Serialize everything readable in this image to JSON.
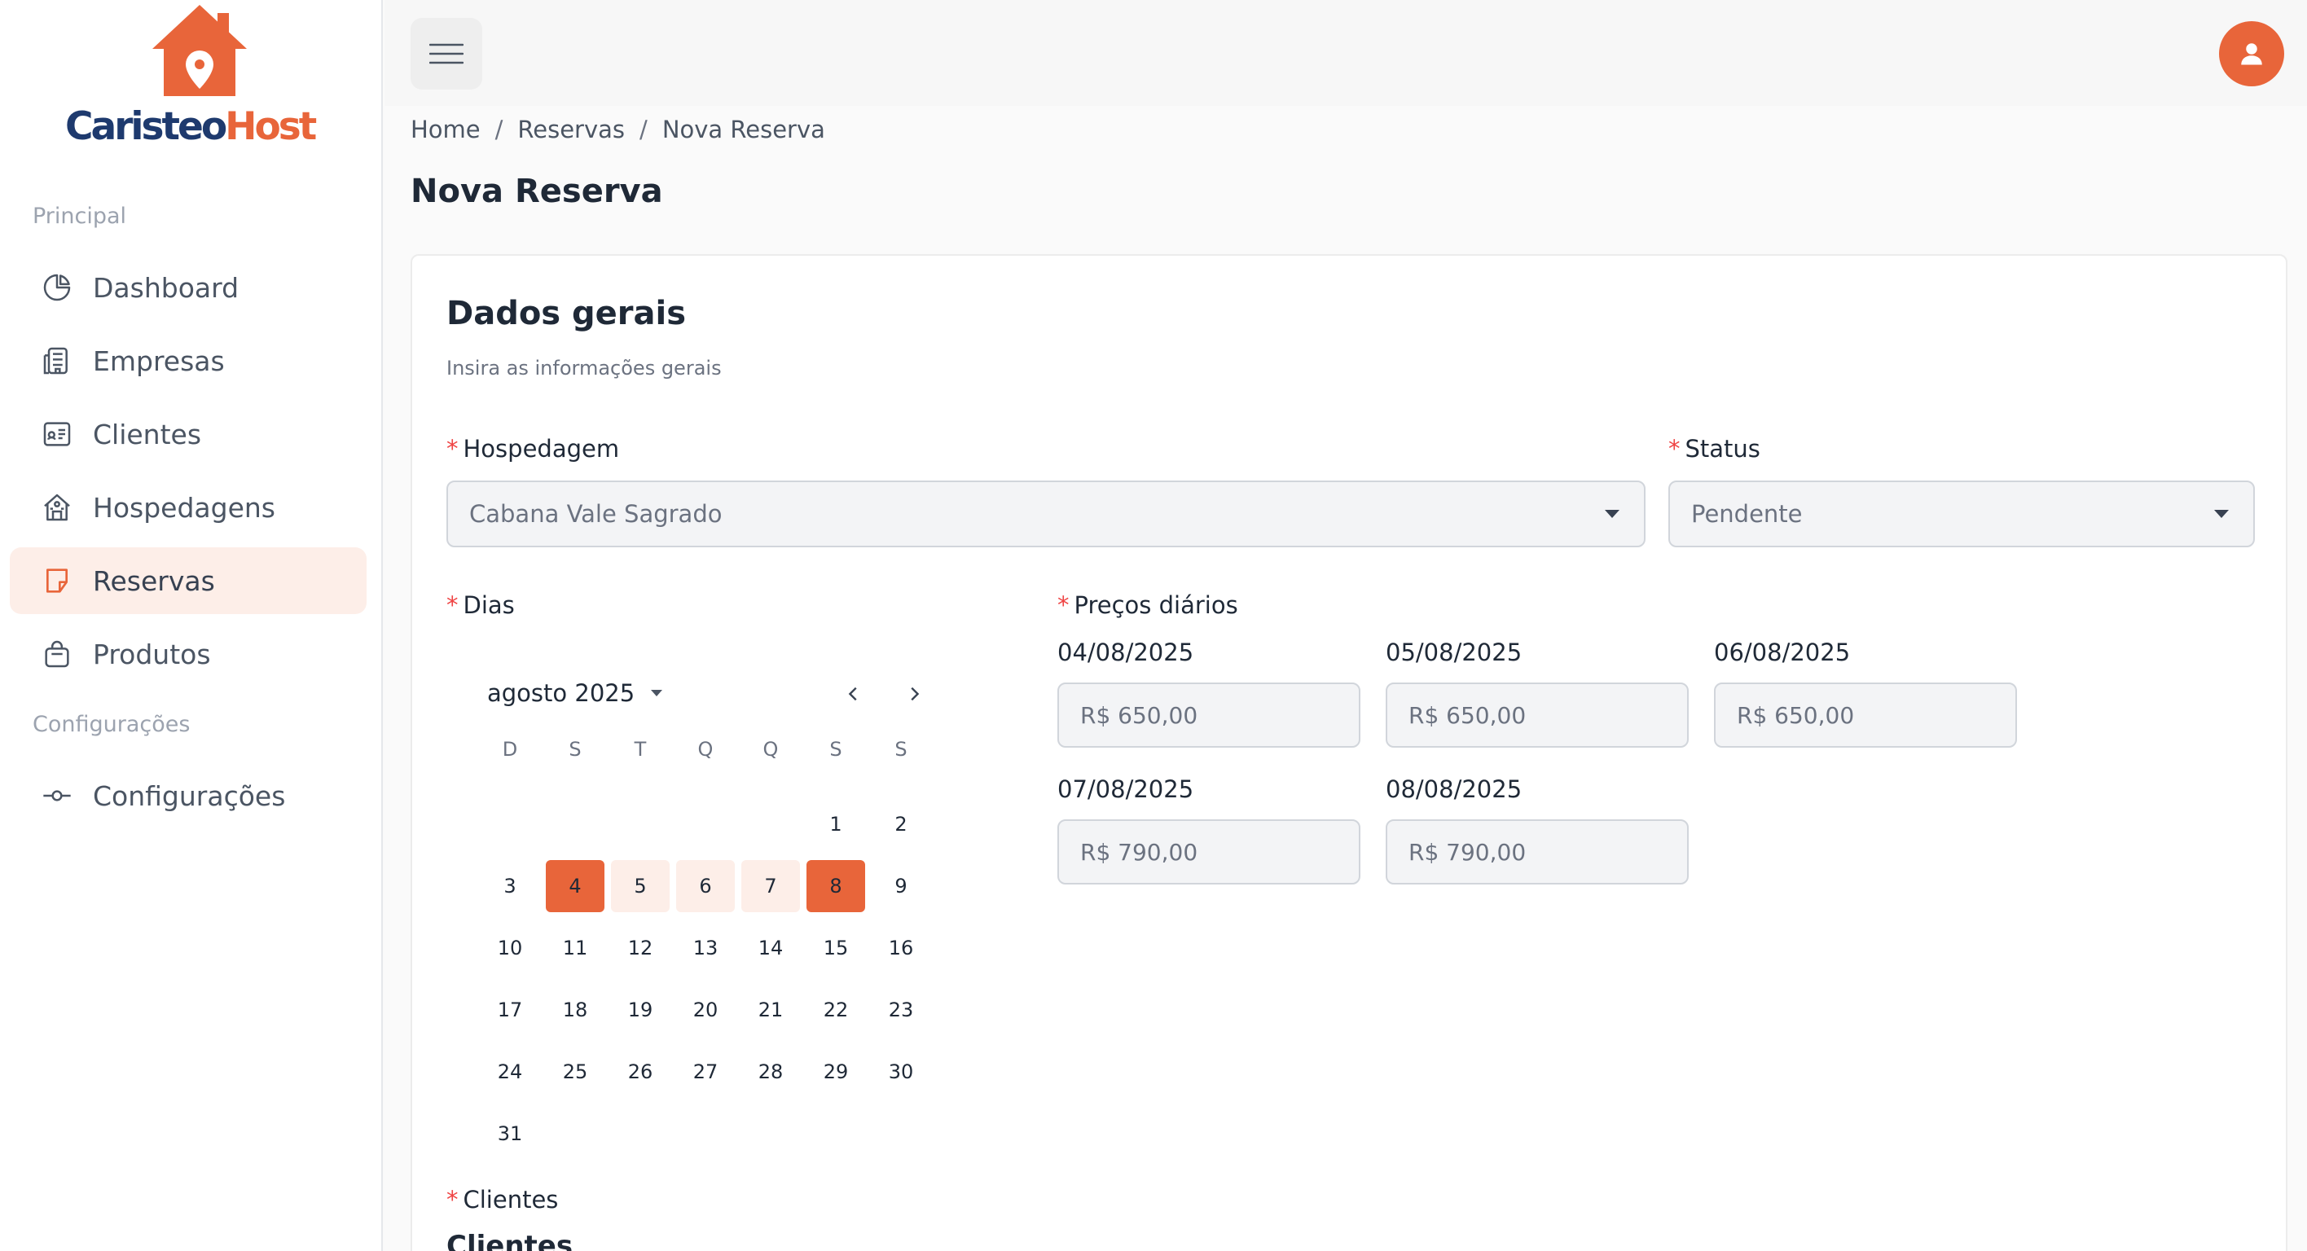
{
  "brand": {
    "name_part1": "Caristeo",
    "name_part2": "Host",
    "color_primary": "#e8653a",
    "color_dark": "#1e3a6e"
  },
  "sidebar": {
    "section_main": "Principal",
    "section_config": "Configurações",
    "items": [
      {
        "label": "Dashboard",
        "icon": "pie-chart-icon"
      },
      {
        "label": "Empresas",
        "icon": "building-icon"
      },
      {
        "label": "Clientes",
        "icon": "id-card-icon"
      },
      {
        "label": "Hospedagens",
        "icon": "house-icon"
      },
      {
        "label": "Reservas",
        "icon": "booking-icon",
        "active": true
      },
      {
        "label": "Produtos",
        "icon": "bag-icon"
      }
    ],
    "config_item": {
      "label": "Configurações",
      "icon": "commit-icon"
    }
  },
  "breadcrumb": [
    "Home",
    "Reservas",
    "Nova Reserva"
  ],
  "page_title": "Nova Reserva",
  "card": {
    "title": "Dados gerais",
    "subtitle": "Insira as informações gerais"
  },
  "form": {
    "hospedagem_label": "Hospedagem",
    "hospedagem_value": "Cabana Vale Sagrado",
    "status_label": "Status",
    "status_value": "Pendente",
    "dias_label": "Dias",
    "precos_label": "Preços diários",
    "clientes_label": "Clientes",
    "clientes_section": "Clientes"
  },
  "calendar": {
    "month": "agosto 2025",
    "weekdays": [
      "D",
      "S",
      "T",
      "Q",
      "Q",
      "S",
      "S"
    ],
    "weeks": [
      [
        "",
        "",
        "",
        "",
        "",
        "1",
        "2"
      ],
      [
        "3",
        "4",
        "5",
        "6",
        "7",
        "8",
        "9"
      ],
      [
        "10",
        "11",
        "12",
        "13",
        "14",
        "15",
        "16"
      ],
      [
        "17",
        "18",
        "19",
        "20",
        "21",
        "22",
        "23"
      ],
      [
        "24",
        "25",
        "26",
        "27",
        "28",
        "29",
        "30"
      ],
      [
        "31",
        "",
        "",
        "",
        "",
        "",
        ""
      ]
    ],
    "selected_start": "4",
    "selected_end": "8",
    "in_range": [
      "5",
      "6",
      "7"
    ]
  },
  "prices": [
    {
      "date": "04/08/2025",
      "value": "R$ 650,00"
    },
    {
      "date": "05/08/2025",
      "value": "R$ 650,00"
    },
    {
      "date": "06/08/2025",
      "value": "R$ 650,00"
    },
    {
      "date": "07/08/2025",
      "value": "R$ 790,00"
    },
    {
      "date": "08/08/2025",
      "value": "R$ 790,00"
    }
  ]
}
